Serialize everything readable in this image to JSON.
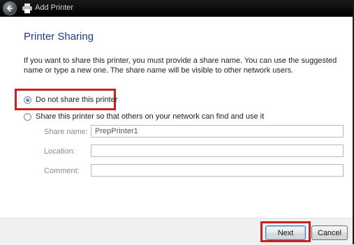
{
  "window": {
    "title": "Add Printer"
  },
  "page": {
    "heading": "Printer Sharing",
    "description": "If you want to share this printer, you must provide a share name. You can use the suggested name or type a new one. The share name will be visible to other network users."
  },
  "options": {
    "do_not_share_label": "Do not share this printer",
    "share_label": "Share this printer so that others on your network can find and use it",
    "selected": "do_not_share"
  },
  "fields": {
    "share_name_label": "Share name:",
    "share_name_value": "PrepPrinter1",
    "location_label": "Location:",
    "location_value": "",
    "comment_label": "Comment:",
    "comment_value": ""
  },
  "buttons": {
    "next_label": "Next",
    "cancel_label": "Cancel"
  },
  "colors": {
    "heading": "#1f3c88",
    "highlight": "#cc1f1f",
    "titlebar": "#000000"
  }
}
